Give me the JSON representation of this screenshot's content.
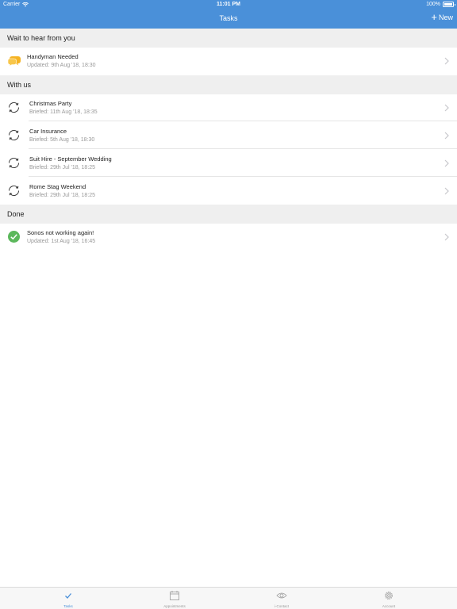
{
  "status_bar": {
    "carrier": "Carrier",
    "time": "11:01 PM",
    "battery": "100%",
    "battery_level": 1.0
  },
  "nav": {
    "title": "Tasks",
    "new_label": "New"
  },
  "sections": [
    {
      "header": "Wait to hear from you",
      "items": [
        {
          "title": "Handyman Needed",
          "subtitle": "Updated: 9th Aug '18, 18:30",
          "icon": "chat-bubble-icon"
        }
      ]
    },
    {
      "header": "With us",
      "items": [
        {
          "title": "Christmas Party",
          "subtitle": "Briefed: 11th Aug '18, 18:35",
          "icon": "sync-icon"
        },
        {
          "title": "Car Insurance",
          "subtitle": "Briefed: 5th Aug '18, 18:30",
          "icon": "sync-icon"
        },
        {
          "title": "Suit Hire - September Wedding",
          "subtitle": "Briefed: 29th Jul '18, 18:25",
          "icon": "sync-icon"
        },
        {
          "title": "Rome Stag Weekend",
          "subtitle": "Briefed: 29th Jul '18, 18:25",
          "icon": "sync-icon"
        }
      ]
    },
    {
      "header": "Done",
      "items": [
        {
          "title": "Sonos not working again!",
          "subtitle": "Updated: 1st Aug '18, 16:45",
          "icon": "check-circle-icon"
        }
      ]
    }
  ],
  "tab_bar": [
    {
      "label": "Tasks",
      "icon": "checkmark-icon",
      "active": true
    },
    {
      "label": "Appointments",
      "icon": "calendar-icon",
      "active": false
    },
    {
      "label": "i-Contact",
      "icon": "eye-icon",
      "active": false
    },
    {
      "label": "Account",
      "icon": "gear-icon",
      "active": false
    }
  ],
  "colors": {
    "accent": "#4a90d9",
    "chat": "#f5b323",
    "done": "#5cb85c"
  }
}
